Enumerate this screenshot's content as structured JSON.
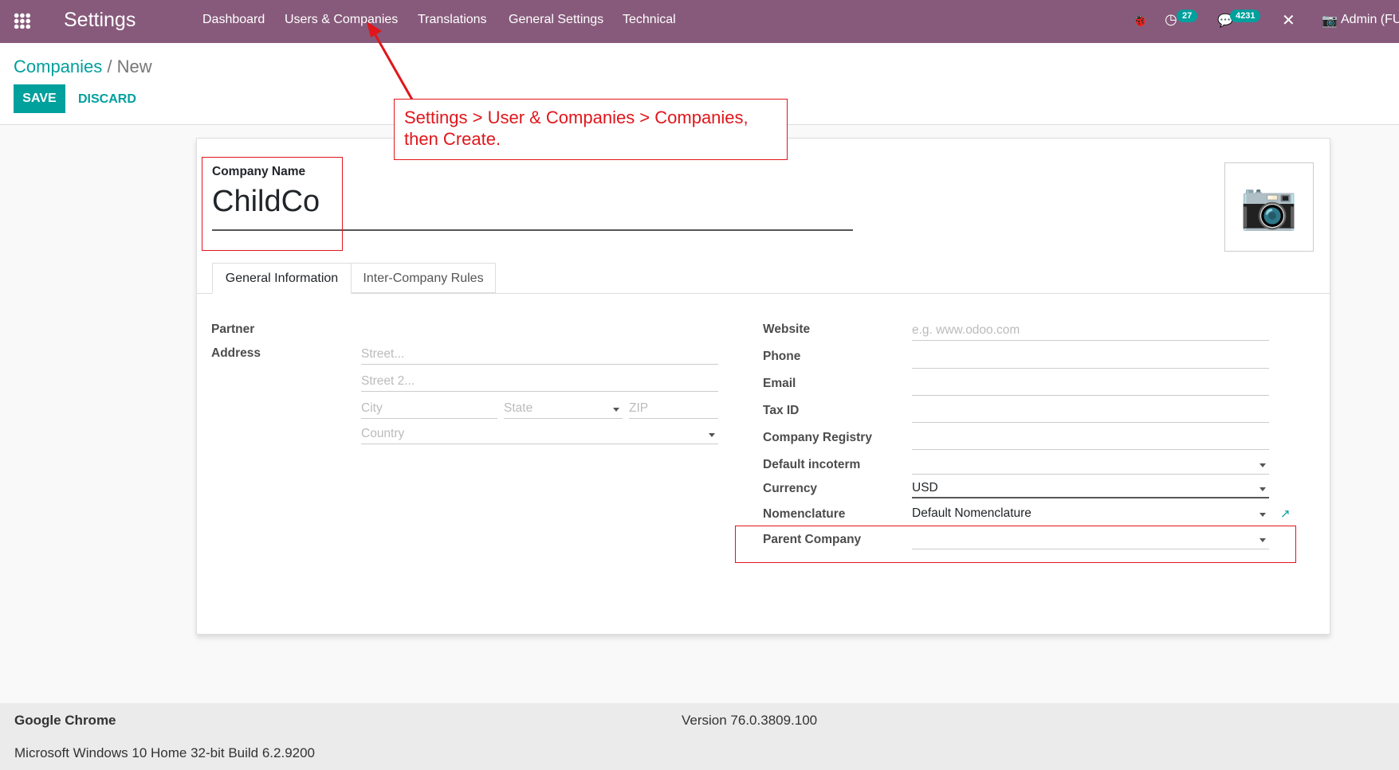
{
  "navbar": {
    "app_title": "Settings",
    "menu": [
      "Dashboard",
      "Users & Companies",
      "Translations",
      "General Settings",
      "Technical"
    ],
    "activity_count": "27",
    "message_count": "4231",
    "user": "Admin (FU"
  },
  "breadcrumb": {
    "parent": "Companies",
    "separator": "/",
    "current": "New"
  },
  "buttons": {
    "save": "SAVE",
    "discard": "DISCARD"
  },
  "annotation": "Settings > User & Companies > Companies, then Create.",
  "form": {
    "company_name_label": "Company Name",
    "company_name": "ChildCo",
    "tabs": [
      "General Information",
      "Inter-Company Rules"
    ],
    "left": {
      "partner_label": "Partner",
      "address_label": "Address",
      "street_ph": "Street...",
      "street2_ph": "Street 2...",
      "city_ph": "City",
      "state_ph": "State",
      "zip_ph": "ZIP",
      "country_ph": "Country"
    },
    "right": {
      "website_label": "Website",
      "website_ph": "e.g. www.odoo.com",
      "phone_label": "Phone",
      "email_label": "Email",
      "taxid_label": "Tax ID",
      "registry_label": "Company Registry",
      "incoterm_label": "Default incoterm",
      "currency_label": "Currency",
      "currency": "USD",
      "nomenclature_label": "Nomenclature",
      "nomenclature": "Default Nomenclature",
      "parent_label": "Parent Company"
    }
  },
  "footer": {
    "browser": "Google Chrome",
    "version": "Version 76.0.3809.100",
    "os": "Microsoft Windows 10 Home 32-bit Build 6.2.9200"
  },
  "colors": {
    "brand": "#875a7b",
    "accent": "#00a09d",
    "annotation": "#e0161b"
  }
}
